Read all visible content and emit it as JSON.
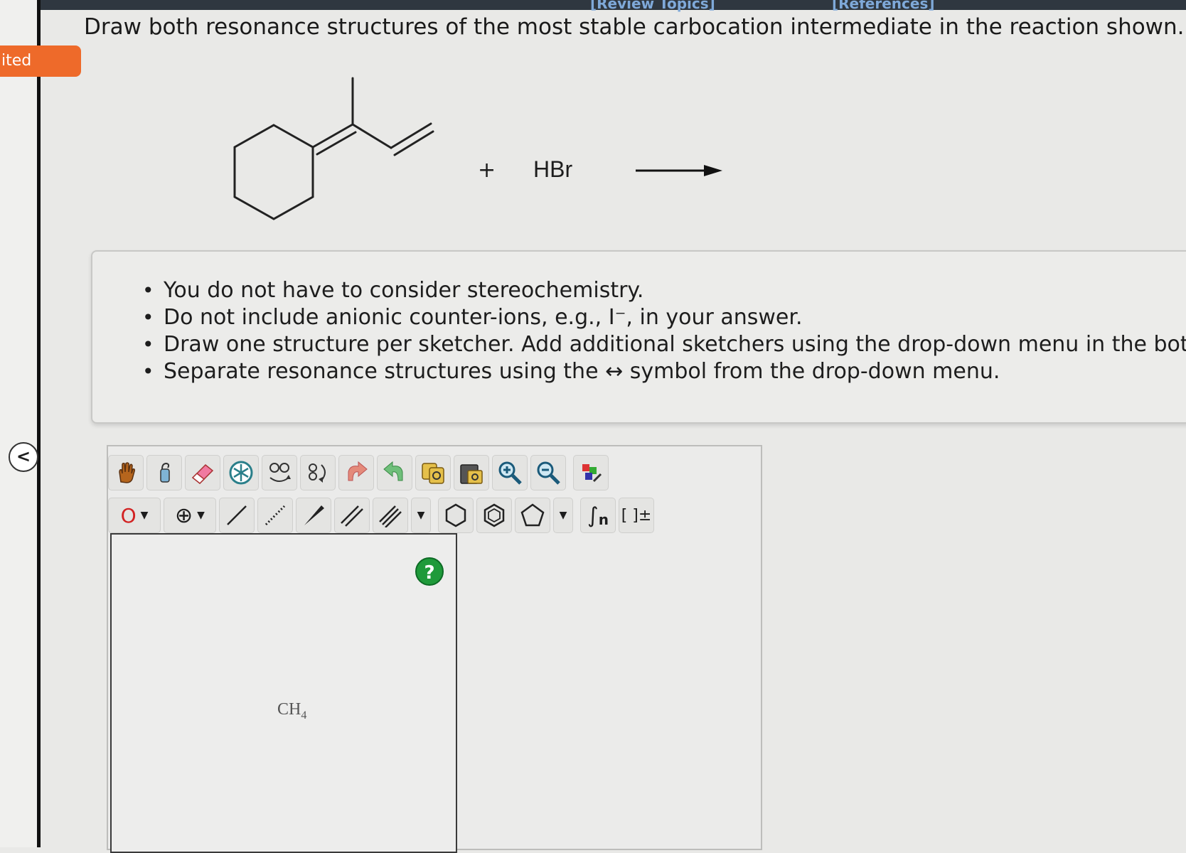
{
  "header": {
    "link_review": "[Review Topics]",
    "link_references": "[References]",
    "status_tab": "ited"
  },
  "question": {
    "prompt": "Draw both resonance structures of the most stable carbocation intermediate in the reaction shown.",
    "plus": "+",
    "reagent": "HBr"
  },
  "instructions": [
    "You do not have to consider stereochemistry.",
    "Do not include anionic counter-ions, e.g., I⁻, in your answer.",
    "Draw one structure per sketcher. Add additional sketchers using the drop-down menu in the bottom",
    "Separate resonance structures using the ↔ symbol from the drop-down menu."
  ],
  "sketcher": {
    "toolbar_top": [
      "hand-tool",
      "lasso-tool",
      "eraser-tool",
      "ring-template-tool",
      "chain-rotate-tool",
      "flip-tool",
      "undo",
      "redo",
      "copy",
      "paste",
      "zoom-in",
      "zoom-out",
      "clean-structure"
    ],
    "toolbar_bottom": [
      "atom-menu",
      "charge-menu",
      "single-bond",
      "hashed-bond",
      "wedge-bond",
      "double-bond",
      "triple-bond",
      "bond-dropdown",
      "hexagon-ring",
      "benzene-ring",
      "pentagon-ring",
      "ring-dropdown",
      "sgroup",
      "bracket-charge"
    ],
    "atom_label": "O",
    "charge_symbol": "⊕",
    "sgroup_label": "n",
    "bracket_label": "[ ]±",
    "help_label": "?",
    "canvas_formula_main": "CH",
    "canvas_formula_sub": "4",
    "collapse_label": "<"
  },
  "colors": {
    "accent_orange": "#ee6a2a",
    "help_green": "#1f9a3a",
    "atom_red": "#d22222"
  }
}
